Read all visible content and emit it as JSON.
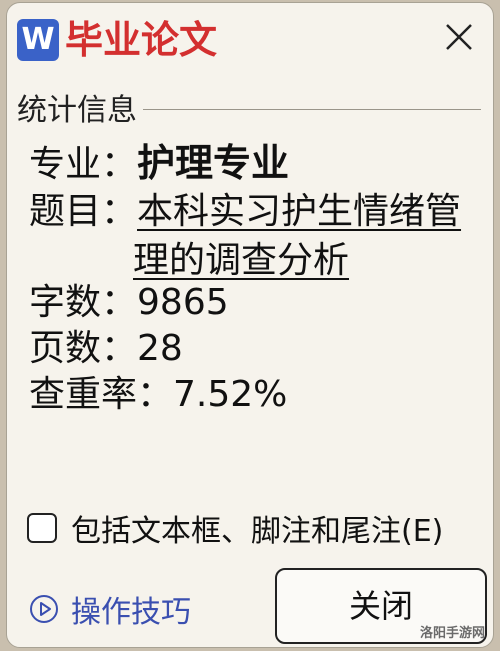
{
  "window": {
    "app_icon_letter": "W",
    "title": "毕业论文"
  },
  "section": {
    "title": "统计信息"
  },
  "stats": {
    "major_label": "专业：",
    "major_value": "护理专业",
    "topic_label": "题目：",
    "topic_line1": "本科实习护生情绪管",
    "topic_line2": "理的调查分析",
    "words_label": "字数：",
    "words_value": "9865",
    "pages_label": "页数：",
    "pages_value": "28",
    "dup_label": "查重率：",
    "dup_value": "7.52%"
  },
  "options": {
    "include_label": "包括文本框、脚注和尾注(E)",
    "include_checked": false
  },
  "footer": {
    "tips_label": "操作技巧",
    "close_label": "关闭"
  },
  "watermark": "洛阳手游网",
  "colors": {
    "title": "#d32f2f",
    "app_icon": "#3a62c8",
    "link": "#3a4fb0"
  }
}
